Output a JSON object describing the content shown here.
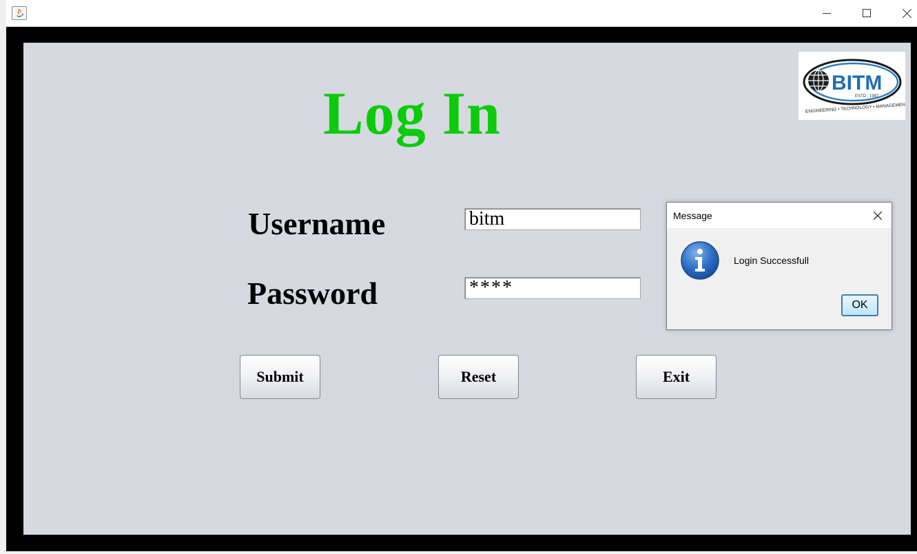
{
  "window": {
    "title": "",
    "controls": {
      "minimize": "minimize-icon",
      "maximize": "maximize-icon",
      "close": "close-icon"
    }
  },
  "logo": {
    "text": "BITM",
    "estd": "ESTD : 1997",
    "tagline": "ENGINEERING • TECHNOLOGY • MANAGEMENT"
  },
  "form": {
    "title": "Log In",
    "title_color": "#0acb0a",
    "username_label": "Username",
    "password_label": "Password",
    "username_value": "bitm",
    "password_value": "****"
  },
  "buttons": {
    "submit": "Submit",
    "reset": "Reset",
    "exit": "Exit"
  },
  "dialog": {
    "title": "Message",
    "message": "Login Successfull",
    "ok": "OK",
    "icon": "info-icon"
  },
  "colors": {
    "content_bg": "#d6d9e0",
    "frame_bg": "#000000",
    "ok_border": "#3c7fb1"
  }
}
